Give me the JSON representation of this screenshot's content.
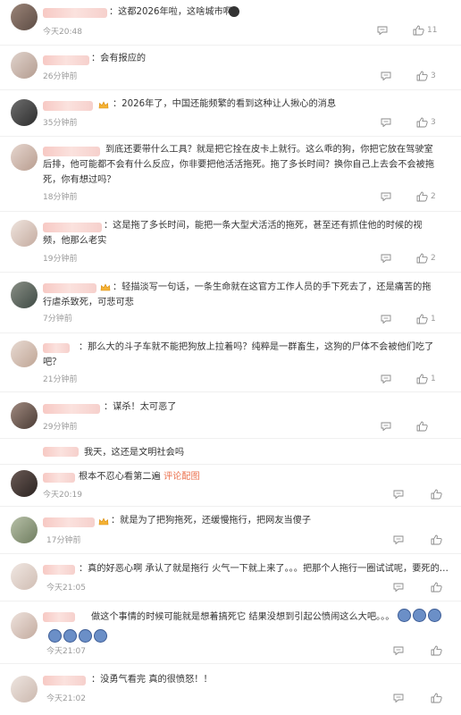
{
  "comments": [
    {
      "text": "：这都2026年啦，这啥城市啊",
      "time": "今天20:48",
      "likes": "11"
    },
    {
      "text": "：会有报应的",
      "time": "26分钟前",
      "likes": "3"
    },
    {
      "text": "：2026年了，中国还能频繁的看到这种让人揪心的消息",
      "time": "35分钟前",
      "likes": "3"
    },
    {
      "text": "到底还要带什么工具？就是把它拴在皮卡上就行。这么乖的狗，你把它放在驾驶室后排，他可能都不会有什么反应，你非要把他活活拖死。拖了多长时间？换你自己上去会不会被拖死，你有想过吗？",
      "time": "18分钟前",
      "likes": "2"
    },
    {
      "text": "：这是拖了多长时间，能把一条大型犬活活的拖死，甚至还有抓住他的时候的视频，他那么老实",
      "time": "19分钟前",
      "likes": "2"
    },
    {
      "text": "：轻描淡写一句话，一条生命就在这官方工作人员的手下死去了，还是痛苦的拖行虐杀致死，可悲可悲",
      "time": "7分钟前",
      "likes": "1"
    },
    {
      "text": "：那么大的斗子车就不能把狗放上拉着吗？纯粹是一群畜生，这狗的尸体不会被他们吃了吧？",
      "time": "21分钟前",
      "likes": "1"
    },
    {
      "text": "：谋杀！太可恶了",
      "time": "29分钟前",
      "likes": ""
    },
    {
      "text": "我天，这还是文明社会吗",
      "time": "",
      "likes": ""
    },
    {
      "text": "根本不忍心看第二遍",
      "link": "评论配图",
      "time": "今天20:19",
      "likes": ""
    },
    {
      "text": "：就是为了把狗拖死，还缓慢拖行，把网友当傻子",
      "time": "17分钟前",
      "likes": ""
    },
    {
      "text": "：真的好恶心啊 承认了就是拖行 火气一下就上来了。。。把那个人拖行一圈试试呢，要死的…",
      "time": "今天21:05",
      "likes": ""
    },
    {
      "text": "做这个事情的时候可能就是想着搞死它 结果没想到引起公愤闹这么大吧。。。",
      "time": "今天21:07",
      "likes": ""
    },
    {
      "text": "：没勇气看完 真的很愤怒！！",
      "time": "今天21:02",
      "likes": ""
    }
  ],
  "icons": {
    "reply": "comment-icon",
    "like": "thumbs-up-icon",
    "emoji": "crying-emoji-icon",
    "badge": "vip-crown-icon"
  },
  "colors": {
    "link": "#eb7350",
    "meta": "#9a9a9a",
    "username_blur": "#f7c9c4"
  }
}
